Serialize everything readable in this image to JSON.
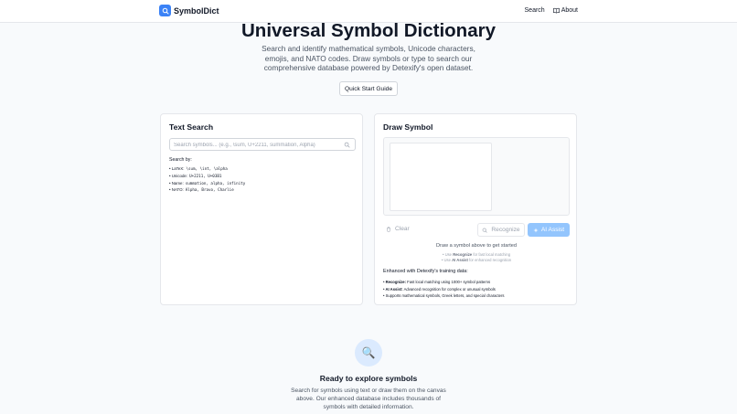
{
  "header": {
    "brand": "SymbolDict",
    "nav": {
      "search": "Search",
      "about": "About"
    }
  },
  "hero": {
    "title": "Universal Symbol Dictionary",
    "subtitle": "Search and identify mathematical symbols, Unicode characters, emojis, and NATO codes. Draw symbols or type to search our comprehensive database powered by Detexify's open dataset.",
    "guide_button": "Quick Start Guide"
  },
  "text_search": {
    "title": "Text Search",
    "placeholder": "Search symbols... (e.g., \\sum, U+2211, summation, Alpha)",
    "value": "",
    "search_by_label": "Search by:",
    "search_by": [
      {
        "label": "• LaTeX:",
        "examples": "\\sum, \\int, \\alpha"
      },
      {
        "label": "• Unicode:",
        "examples": "U+2211, U+03B1"
      },
      {
        "label": "• Name:",
        "examples": "summation, alpha, infinity"
      },
      {
        "label": "• NATO:",
        "examples": "Alpha, Bravo, Charlie"
      }
    ]
  },
  "draw_symbol": {
    "title": "Draw Symbol",
    "clear_button": "Clear",
    "recognize_button": "Recognize",
    "ai_assist_button": "AI Assist",
    "hint_title": "Draw a symbol above to get started",
    "hint_1_prefix": "• Use",
    "hint_1_bold": "Recognize",
    "hint_1_suffix": "for fast local matching",
    "hint_2_prefix": "• Use",
    "hint_2_bold": "AI Assist",
    "hint_2_suffix": "for enhanced recognition",
    "enhanced_title": "Enhanced with Detexify's training data:",
    "enhanced": [
      {
        "bold": "• Recognize:",
        "text": "Fast local matching using 1000+ symbol patterns"
      },
      {
        "bold": "• AI Assist:",
        "text": "Advanced recognition for complex or unusual symbols"
      },
      {
        "bold": "",
        "text": "• Supports mathematical symbols, Greek letters, and special characters"
      }
    ]
  },
  "empty_state": {
    "icon": "🔍",
    "title": "Ready to explore symbols",
    "description": "Search for symbols using text or draw them on the canvas above. Our enhanced database includes thousands of symbols with detailed information."
  },
  "colors": {
    "accent": "#3b82f6",
    "accent_light": "#93c5fd",
    "empty_circle": "#dbeafe"
  }
}
